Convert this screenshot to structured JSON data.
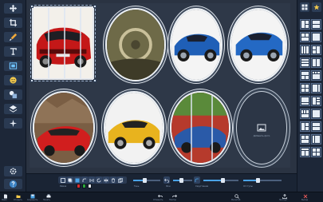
{
  "left_toolbar": {
    "tools": [
      {
        "icon": "move-icon"
      },
      {
        "icon": "crop-icon"
      },
      {
        "icon": "brush-icon"
      },
      {
        "icon": "text-icon"
      },
      {
        "icon": "frame-icon"
      },
      {
        "icon": "sticker-icon"
      },
      {
        "icon": "shape-icon"
      },
      {
        "icon": "layers-icon"
      },
      {
        "icon": "effects-icon"
      }
    ],
    "bottom_tools": [
      {
        "icon": "settings-icon"
      },
      {
        "icon": "help-icon"
      }
    ]
  },
  "right_panel": {
    "top_buttons": [
      {
        "icon": "grid-icon"
      },
      {
        "icon": "star-icon"
      }
    ]
  },
  "collage": {
    "placeholder_label": "Добавить фото"
  },
  "bottom_panel": {
    "groups": [
      {
        "label": "Рамка"
      },
      {
        "label": "Тень"
      },
      {
        "label": "Фон"
      },
      {
        "label": "Скругление"
      },
      {
        "label": "Отступы"
      }
    ],
    "colors": [
      "#d92b2b",
      "#2aa23a",
      "#e4e8ee"
    ]
  },
  "statusbar": {
    "items": [
      {
        "label": "Файл"
      },
      {
        "label": "Открыть"
      },
      {
        "label": "Сохранить"
      },
      {
        "label": "Печать"
      },
      {
        "label": "Отменить"
      },
      {
        "label": "Повтор"
      },
      {
        "label": "Масштаб"
      },
      {
        "label": "Экспорт"
      },
      {
        "label": "Выход"
      }
    ]
  },
  "colors": {
    "accent": "#4aa3e6",
    "panel": "#1d2738",
    "canvas": "#2a3342"
  }
}
